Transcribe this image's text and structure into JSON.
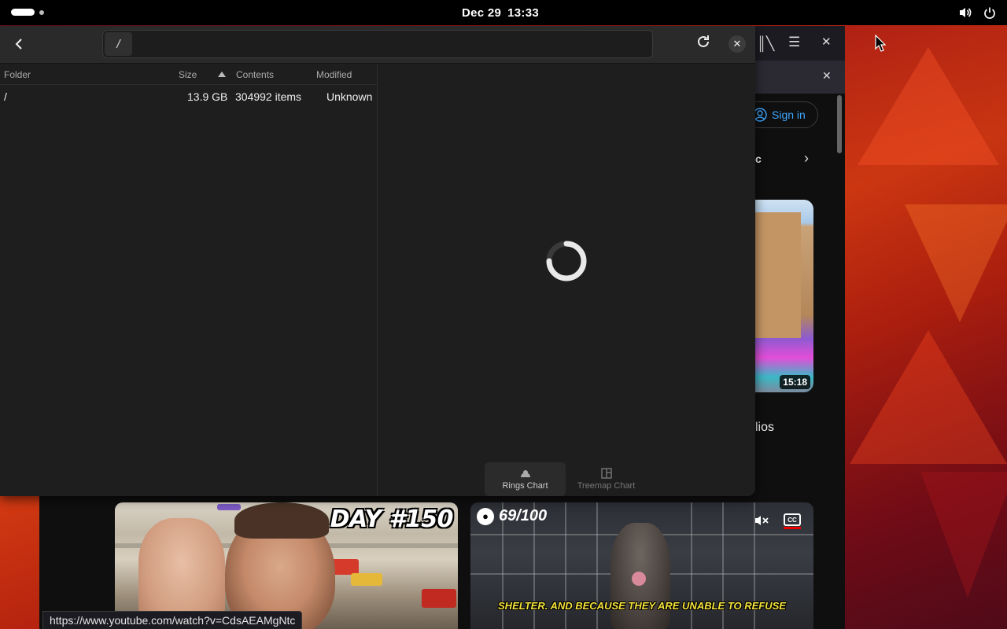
{
  "topbar": {
    "date": "Dec 29",
    "time": "13:33",
    "icons": [
      "volume-icon",
      "power-icon"
    ]
  },
  "background_browser": {
    "signin_label": "Sign in",
    "chip_label": "c",
    "right_thumb_duration": "15:18",
    "side_text": "lios",
    "video1_overlay": "DAY #150",
    "video2_score": "69/100",
    "video2_caption": "SHELTER. AND BECAUSE THEY ARE UNABLE TO REFUSE",
    "video2_cc": "CC",
    "status_url": "https://www.youtube.com/watch?v=CdsAEAMgNtc"
  },
  "app": {
    "path_value": "/",
    "columns": {
      "folder": "Folder",
      "size": "Size",
      "contents": "Contents",
      "modified": "Modified"
    },
    "rows": [
      {
        "folder": "/",
        "size": "13.9 GB",
        "contents": "304992 items",
        "modified": "Unknown"
      }
    ],
    "chart_modes": {
      "rings": "Rings Chart",
      "treemap": "Treemap Chart",
      "active": "rings"
    }
  },
  "colors": {
    "accent_link": "#3ea6ff",
    "window_bg": "#1e1e1e",
    "caption_yellow": "#f5e33b"
  }
}
